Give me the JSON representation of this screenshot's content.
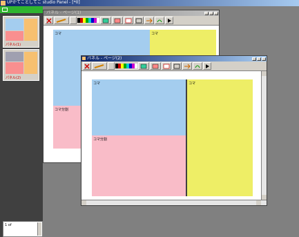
{
  "app": {
    "title": "UPかてことしてこ studio Panel - [*0]",
    "colors": {
      "desktop": "#808080",
      "blue": "#a4cdef",
      "yellow": "#eeee66",
      "pink": "#f9bcc8",
      "orange": "#f7c070",
      "title_active": "#0a246a",
      "green_tab": "#2fb52f"
    }
  },
  "sidebar": {
    "thumbnails": [
      {
        "label": "パネル(1)"
      },
      {
        "label": "パネル(2)"
      }
    ],
    "bottom_label": "1 of"
  },
  "back_window": {
    "title": "パネル - ページ(1)",
    "panels": [
      {
        "label": "コマ"
      },
      {
        "label": "コマ"
      },
      {
        "label": "コマ分割"
      }
    ]
  },
  "front_window": {
    "title": "パネル - ページ(2)",
    "panels": [
      {
        "label": "コマ"
      },
      {
        "label": "コマ"
      },
      {
        "label": "コマ分割"
      }
    ]
  },
  "toolbar": {
    "icons": [
      "scissors-icon",
      "pencil-icon",
      "color-palette",
      "page-icon",
      "layout-icon",
      "grid-icon",
      "frame-icon",
      "arrow-icon",
      "undo-icon",
      "play-icon"
    ]
  }
}
